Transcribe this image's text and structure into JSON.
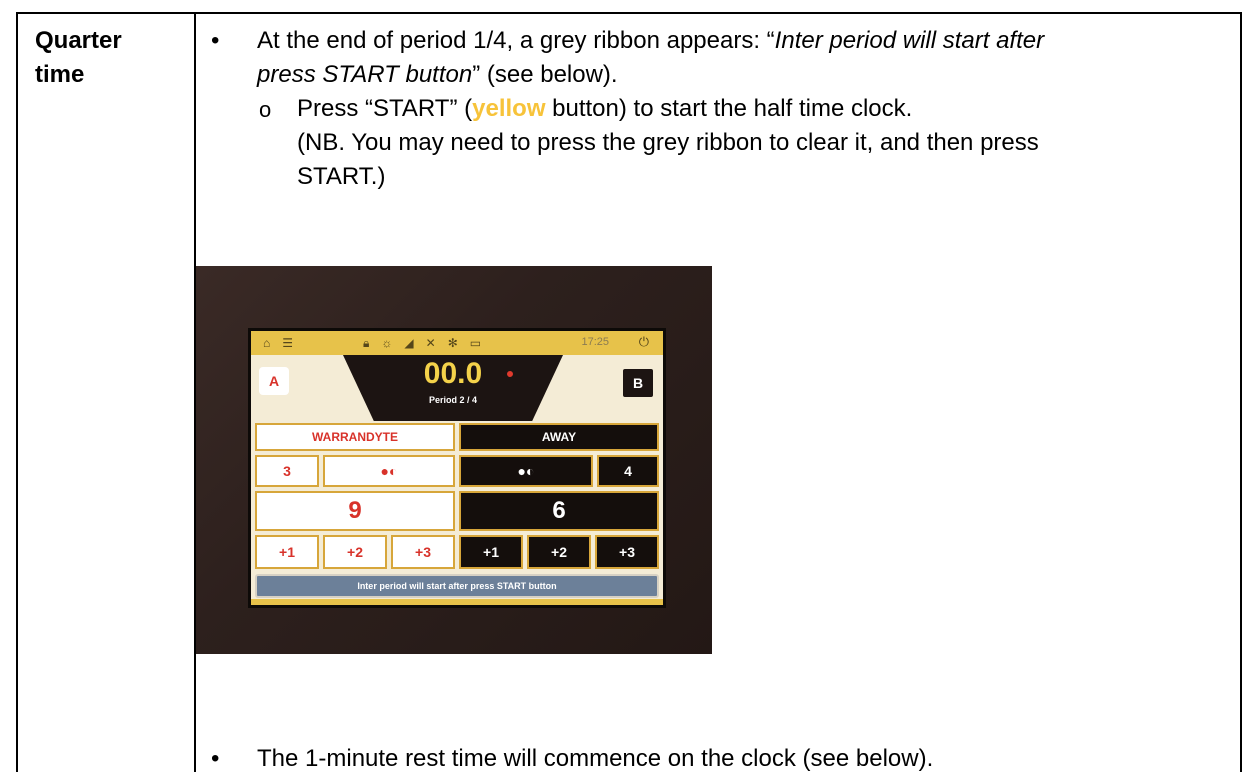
{
  "label": {
    "line1": "Quarter",
    "line2": "time"
  },
  "bullet1": {
    "text1": "At the end of period 1/4, a grey ribbon appears: “",
    "italic1": "Inter period will start after",
    "italic2": "press START button",
    "text2": "” (see below)."
  },
  "sub1": {
    "marker": "o",
    "pre": "Press “START” (",
    "yellow": "yellow",
    "post": " button) to start the half time clock.",
    "note_line1": "(NB. You may need to press the grey ribbon to clear it, and then press",
    "note_line2": "START.)"
  },
  "screen": {
    "time": "17:25",
    "clock": "00.0",
    "period": "Period 2 / 4",
    "team_a_letter": "A",
    "team_b_letter": "B",
    "team_a_name": "WARRANDYTE",
    "team_b_name": "AWAY",
    "team_a_fouls": "3",
    "team_b_fouls": "4",
    "team_a_score": "9",
    "team_b_score": "6",
    "buttons_a": [
      "+1",
      "+2",
      "+3"
    ],
    "buttons_b": [
      "+1",
      "+2",
      "+3"
    ],
    "ribbon": "Inter period will start after press START button"
  },
  "bullet2": {
    "text": "The 1-minute rest time will commence on the clock (see below)."
  },
  "colors": {
    "yellow": "#f7c33a",
    "screen_yellow": "#e7c24a"
  }
}
